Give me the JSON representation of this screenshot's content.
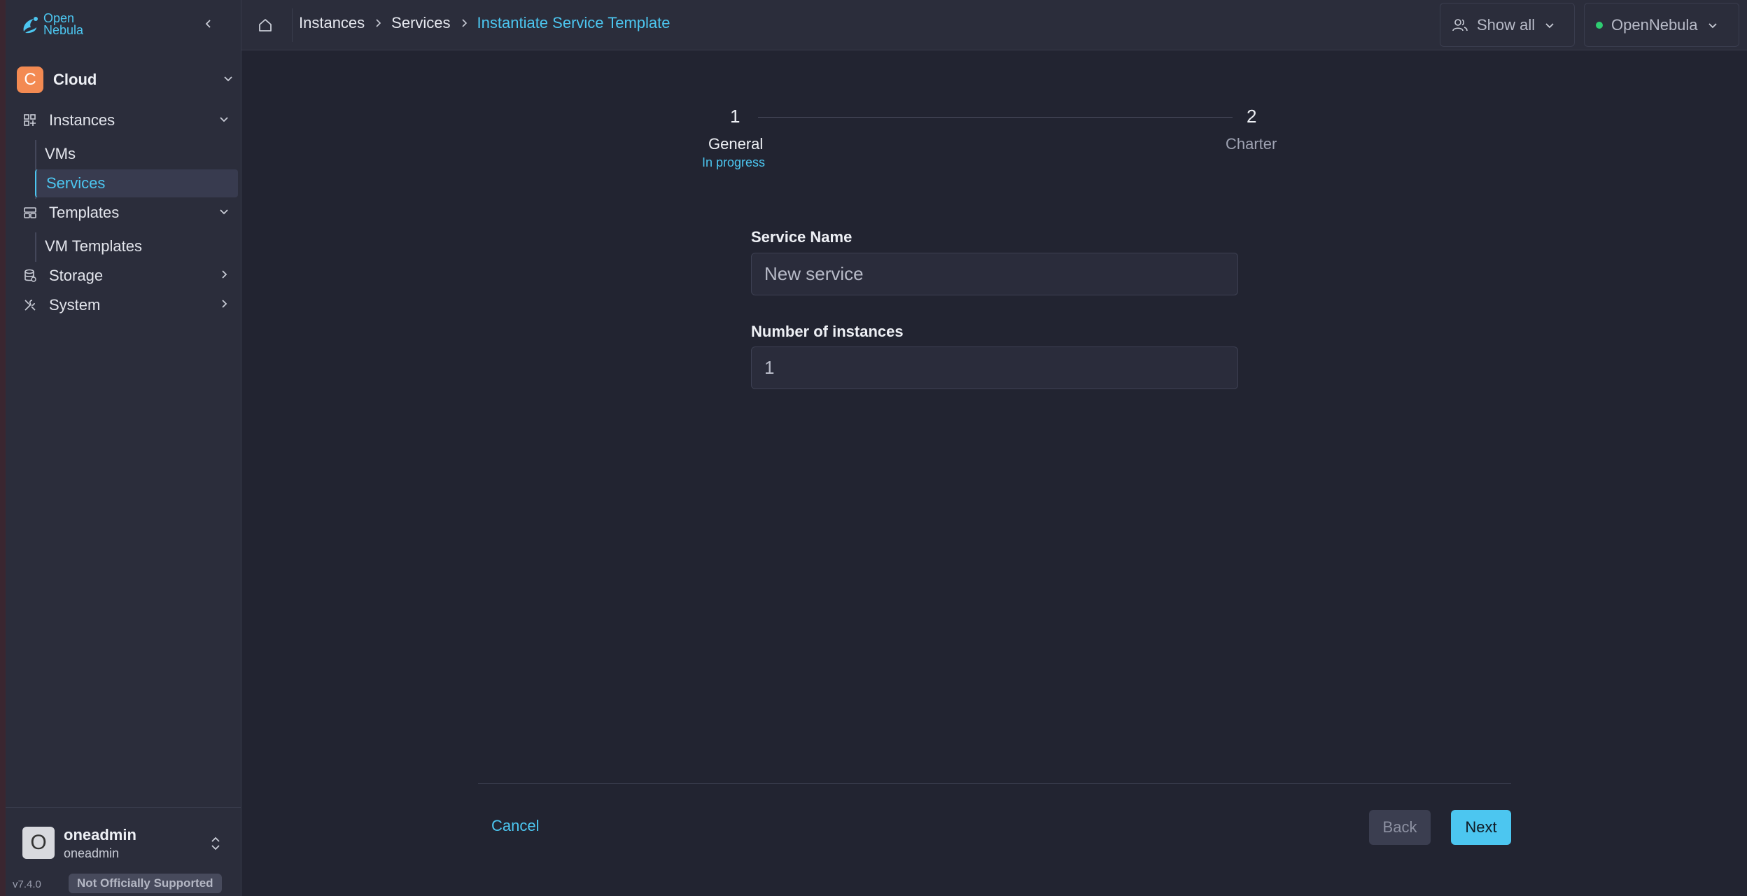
{
  "app": {
    "logo_line1": "Open",
    "logo_line2": "Nebula"
  },
  "sidebar": {
    "group": {
      "initial": "C",
      "label": "Cloud"
    },
    "items": [
      {
        "label": "Instances",
        "icon": "grid-plus-icon",
        "expanded": true
      },
      {
        "label": "VMs"
      },
      {
        "label": "Services",
        "active": true
      },
      {
        "label": "Templates",
        "icon": "layout-icon",
        "expanded": true
      },
      {
        "label": "VM Templates"
      },
      {
        "label": "Storage",
        "icon": "database-icon",
        "expanded": false
      },
      {
        "label": "System",
        "icon": "tools-icon",
        "expanded": false
      }
    ],
    "user": {
      "initial": "O",
      "name": "oneadmin",
      "group": "oneadmin"
    },
    "version": "v7.4.0",
    "support_badge": "Not Officially Supported"
  },
  "header": {
    "breadcrumb": [
      "Instances",
      "Services",
      "Instantiate Service Template"
    ],
    "filter_label": "Show all",
    "zone_label": "OpenNebula",
    "zone_status_color": "#2ecc71"
  },
  "stepper": {
    "steps": [
      {
        "number": "1",
        "title": "General",
        "status": "In progress"
      },
      {
        "number": "2",
        "title": "Charter"
      }
    ]
  },
  "form": {
    "service_name": {
      "label": "Service Name",
      "value": "New service"
    },
    "instances": {
      "label": "Number of instances",
      "value": "1"
    }
  },
  "actions": {
    "cancel": "Cancel",
    "back": "Back",
    "next": "Next"
  },
  "colors": {
    "accent": "#4cc6f0",
    "cloud_avatar": "#f38a52",
    "background": "#222431"
  }
}
